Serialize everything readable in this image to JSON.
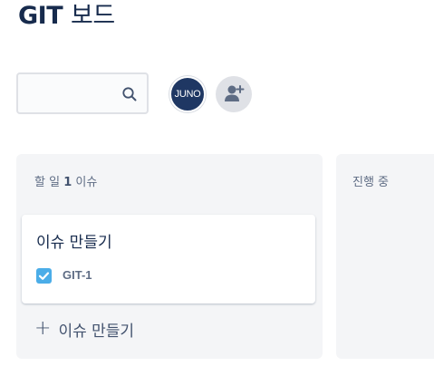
{
  "board": {
    "title_prefix": "GIT",
    "title_suffix": "보드"
  },
  "search": {
    "value": "",
    "placeholder": ""
  },
  "avatar": {
    "initials": "JUNO"
  },
  "columns": [
    {
      "name_prefix": "할 일",
      "count": "1",
      "unit": "이슈",
      "issue": {
        "title": "이슈 만들기",
        "key": "GIT-1",
        "type_icon": "task-checkbox-icon"
      },
      "create_label": "이슈 만들기"
    },
    {
      "name": "진행 중"
    }
  ],
  "colors": {
    "accent": "#4bade8",
    "avatar_bg": "#1f3763",
    "column_bg": "#f4f5f7"
  }
}
